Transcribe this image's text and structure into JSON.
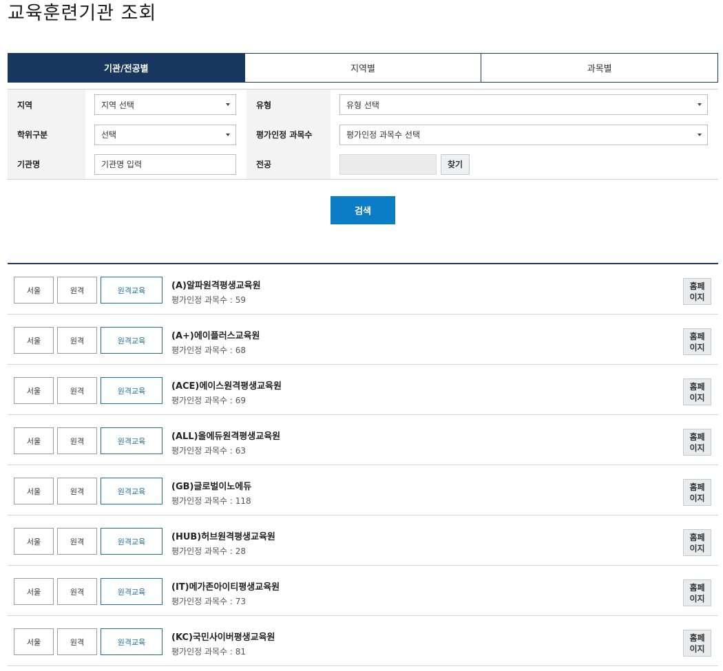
{
  "page_title": "교육훈련기관 조회",
  "tabs": [
    {
      "label": "기관/전공별",
      "active": true
    },
    {
      "label": "지역별",
      "active": false
    },
    {
      "label": "과목별",
      "active": false
    }
  ],
  "filters": {
    "region_label": "지역",
    "region_value": "지역 선택",
    "type_label": "유형",
    "type_value": "유형 선택",
    "degree_label": "학위구분",
    "degree_value": "선택",
    "course_count_label": "평가인정 과목수",
    "course_count_value": "평가인정 과목수 선택",
    "institution_label": "기관명",
    "institution_placeholder": "기관명 입력",
    "major_label": "전공",
    "find_label": "찾기"
  },
  "search_label": "검색",
  "results": [
    {
      "region": "서울",
      "mode": "원격",
      "kind": "원격교육",
      "name": "(A)알파원격평생교육원",
      "count": "평가인정 과목수 : 59",
      "home_line1": "홈페",
      "home_line2": "이지"
    },
    {
      "region": "서울",
      "mode": "원격",
      "kind": "원격교육",
      "name": "(A+)에이플러스교육원",
      "count": "평가인정 과목수 : 68",
      "home_line1": "홈페",
      "home_line2": "이지"
    },
    {
      "region": "서울",
      "mode": "원격",
      "kind": "원격교육",
      "name": "(ACE)에이스원격평생교육원",
      "count": "평가인정 과목수 : 69",
      "home_line1": "홈페",
      "home_line2": "이지"
    },
    {
      "region": "서울",
      "mode": "원격",
      "kind": "원격교육",
      "name": "(ALL)올에듀원격평생교육원",
      "count": "평가인정 과목수 : 63",
      "home_line1": "홈페",
      "home_line2": "이지"
    },
    {
      "region": "서울",
      "mode": "원격",
      "kind": "원격교육",
      "name": "(GB)글로벌이노에듀",
      "count": "평가인정 과목수 : 118",
      "home_line1": "홈페",
      "home_line2": "이지"
    },
    {
      "region": "서울",
      "mode": "원격",
      "kind": "원격교육",
      "name": "(HUB)허브원격평생교육원",
      "count": "평가인정 과목수 : 28",
      "home_line1": "홈페",
      "home_line2": "이지"
    },
    {
      "region": "서울",
      "mode": "원격",
      "kind": "원격교육",
      "name": "(IT)메가존아이티평생교육원",
      "count": "평가인정 과목수 : 73",
      "home_line1": "홈페",
      "home_line2": "이지"
    },
    {
      "region": "서울",
      "mode": "원격",
      "kind": "원격교육",
      "name": "(KC)국민사이버평생교육원",
      "count": "평가인정 과목수 : 81",
      "home_line1": "홈페",
      "home_line2": "이지"
    }
  ],
  "colors": {
    "navy": "#17375e",
    "search_blue": "#0b7dc6",
    "tag_blue": "#1c6e9e"
  }
}
